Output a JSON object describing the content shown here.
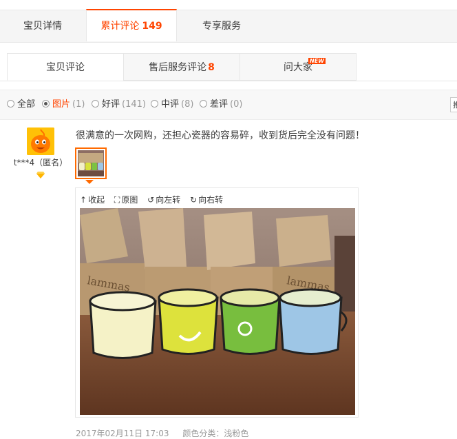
{
  "top_tabs": [
    {
      "label": "宝贝详情"
    },
    {
      "label": "累计评论",
      "count": "149"
    },
    {
      "label": "专享服务"
    }
  ],
  "sub_tabs": [
    {
      "label": "宝贝评论"
    },
    {
      "label": "售后服务评论",
      "count": "8"
    },
    {
      "label": "问大家",
      "badge": "NEW"
    }
  ],
  "filters": [
    {
      "label": "全部",
      "count": ""
    },
    {
      "label": "图片",
      "count": "(1)"
    },
    {
      "label": "好评",
      "count": "(141)"
    },
    {
      "label": "中评",
      "count": "(8)"
    },
    {
      "label": "差评",
      "count": "(0)"
    }
  ],
  "sort_select": {
    "value": "推"
  },
  "review": {
    "username": "t***4（匿名）",
    "text": "很满意的一次网购，还担心瓷器的容易碎，收到货后完全没有问题！",
    "tools": [
      "收起",
      "原图",
      "向左转",
      "向右转"
    ],
    "date": "2017年02月11日 17:03",
    "sku": "颜色分类：浅粉色"
  },
  "colors": {
    "accent": "#ff4400"
  }
}
